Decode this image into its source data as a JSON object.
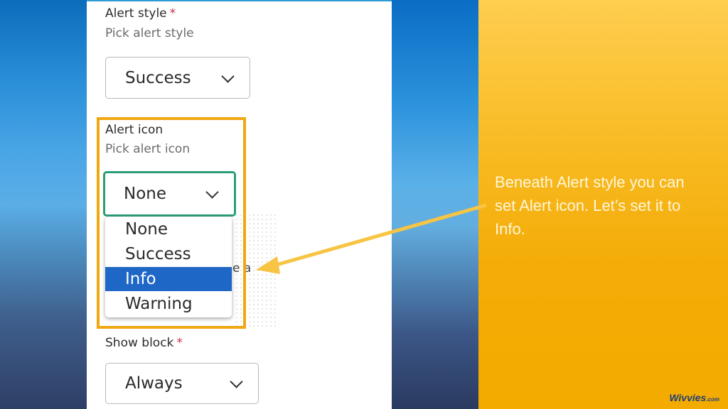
{
  "form": {
    "alert_style": {
      "label": "Alert style",
      "required_mark": "*",
      "hint": "Pick alert style",
      "value": "Success"
    },
    "alert_icon": {
      "label": "Alert icon",
      "hint": "Pick alert icon",
      "value": "None",
      "options": [
        "None",
        "Success",
        "Info",
        "Warning"
      ],
      "highlighted_option": "Info"
    },
    "obscured_text": "e a",
    "show_block": {
      "label": "Show block",
      "required_mark": "*",
      "value": "Always"
    }
  },
  "callout": {
    "text": "Beneath Alert style you can set Alert icon. Let’s set it to Info."
  },
  "logo": {
    "name": "Wivvies",
    "suffix": ".com"
  },
  "colors": {
    "highlight_border": "#f0a712",
    "focus_border": "#2a9d78",
    "selected_option_bg": "#1f67c6",
    "arrow": "#f7c443",
    "required_mark": "#c4314b"
  },
  "icons": [
    "chevron-down-icon",
    "callout-arrow-icon"
  ]
}
